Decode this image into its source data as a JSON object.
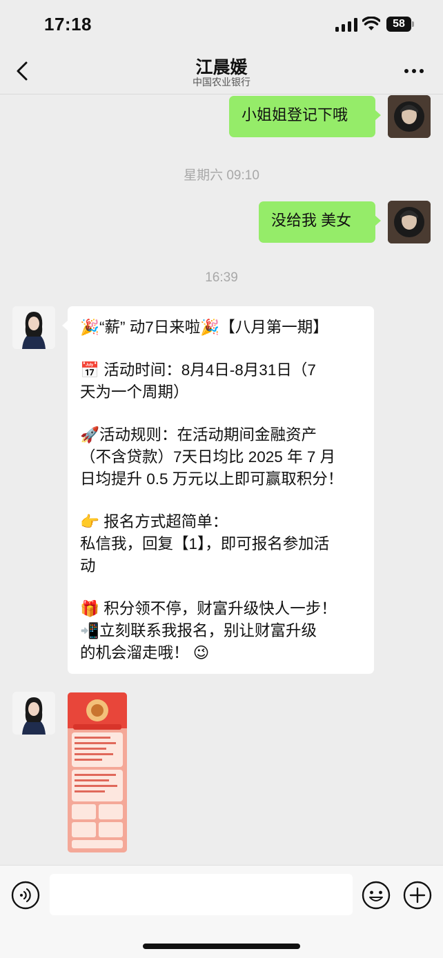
{
  "status_bar": {
    "time": "17:18",
    "battery": "58",
    "icons": [
      "signal-icon",
      "wifi-icon",
      "battery-icon"
    ]
  },
  "header": {
    "title": "江晨媛",
    "subtitle": "中国农业银行",
    "back_icon": "chevron-left-icon",
    "more_icon": "more-icon"
  },
  "messages": {
    "self_1": "小姐姐登记下哦",
    "time_1": "星期六 09:10",
    "self_2": "没给我 美女",
    "time_2": "16:39",
    "long": {
      "l1": "🎉“薪” 动7日来啦🎉【八月第一期】",
      "l2": "📅 活动时间：8月4日-8月31日（7",
      "l3": "天为一个周期）",
      "l4": "🚀活动规则：在活动期间金融资产",
      "l5": "（不含贷款）7天日均比 2025 年 7 月",
      "l6": "日均提升 0.5 万元以上即可赢取积分！",
      "l7": "👉 报名方式超简单：",
      "l8": "私信我，回复【1】，即可报名参加活",
      "l9": "动",
      "l10": "🎁 积分领不停，财富升级快人一步！",
      "l11": "📲立刻联系我报名，别让财富升级",
      "l12": "的机会溜走哦！ 😉"
    }
  },
  "input_bar": {
    "placeholder": "",
    "icons": [
      "voice-icon",
      "emoji-icon",
      "plus-icon"
    ]
  },
  "colors": {
    "chat_bg": "#ededed",
    "self_bubble": "#95ec69",
    "other_bubble": "#ffffff",
    "timestamp": "#a8a8a8"
  }
}
